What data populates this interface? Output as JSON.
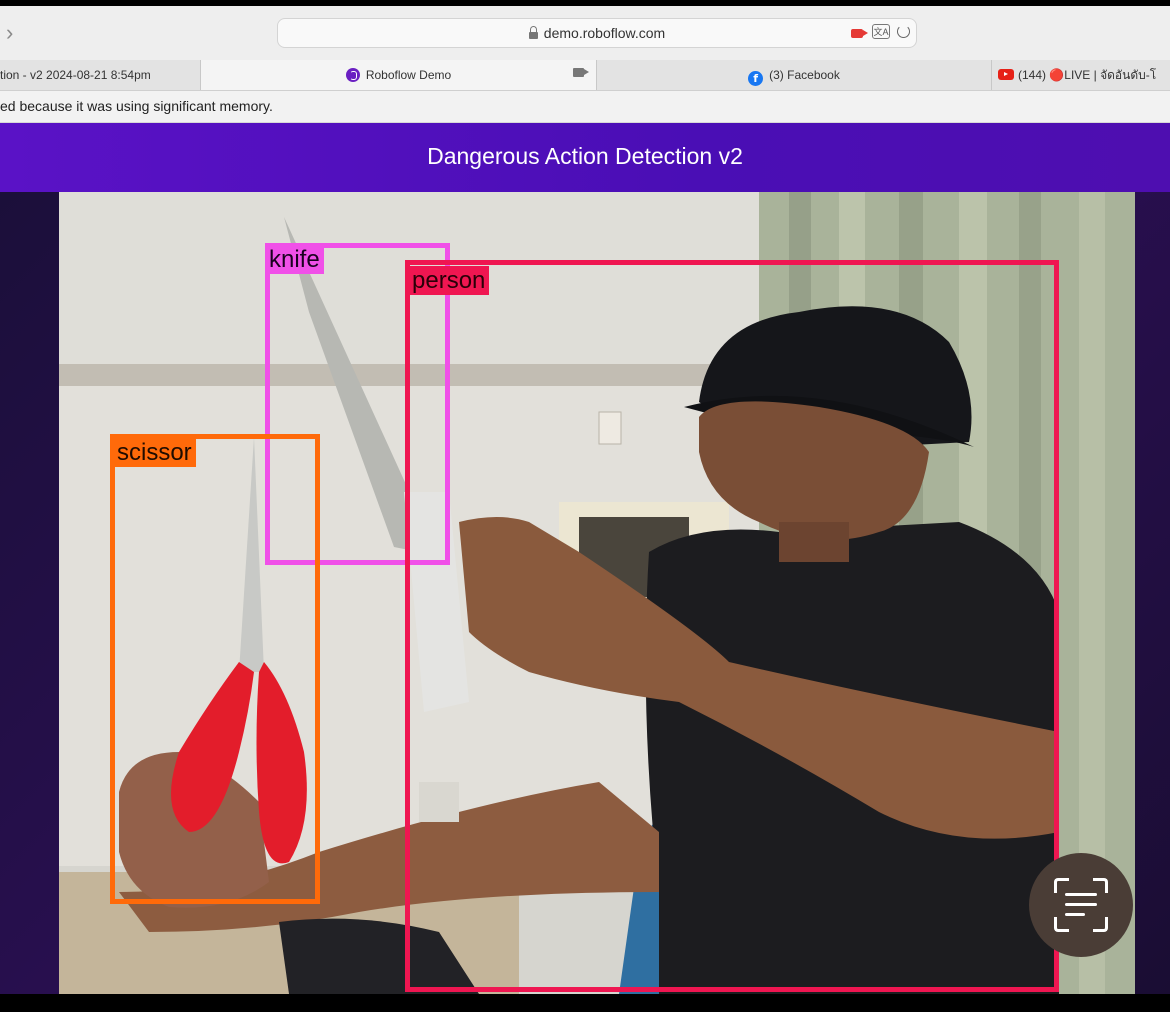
{
  "browser": {
    "url": "demo.roboflow.com",
    "tabs": [
      {
        "title": "tion - v2 2024-08-21 8:54pm",
        "active": false
      },
      {
        "title": "Roboflow Demo",
        "active": true,
        "icon": "roboflow-icon"
      },
      {
        "title": "(3) Facebook",
        "active": false,
        "icon": "facebook-icon"
      },
      {
        "title": "(144) 🔴LIVE | จัดอันดับ-โ",
        "active": false,
        "icon": "youtube-icon"
      }
    ],
    "notice": "ed because it was using significant memory."
  },
  "app": {
    "title": "Dangerous Action Detection v2",
    "accent": "#5a12c6"
  },
  "detections": [
    {
      "label": "knife",
      "color": "#f050e8"
    },
    {
      "label": "person",
      "color": "#ef1651"
    },
    {
      "label": "scissor",
      "color": "#ff6a0a"
    }
  ],
  "controls": {
    "scan_button_icon": "scan-text-icon"
  }
}
